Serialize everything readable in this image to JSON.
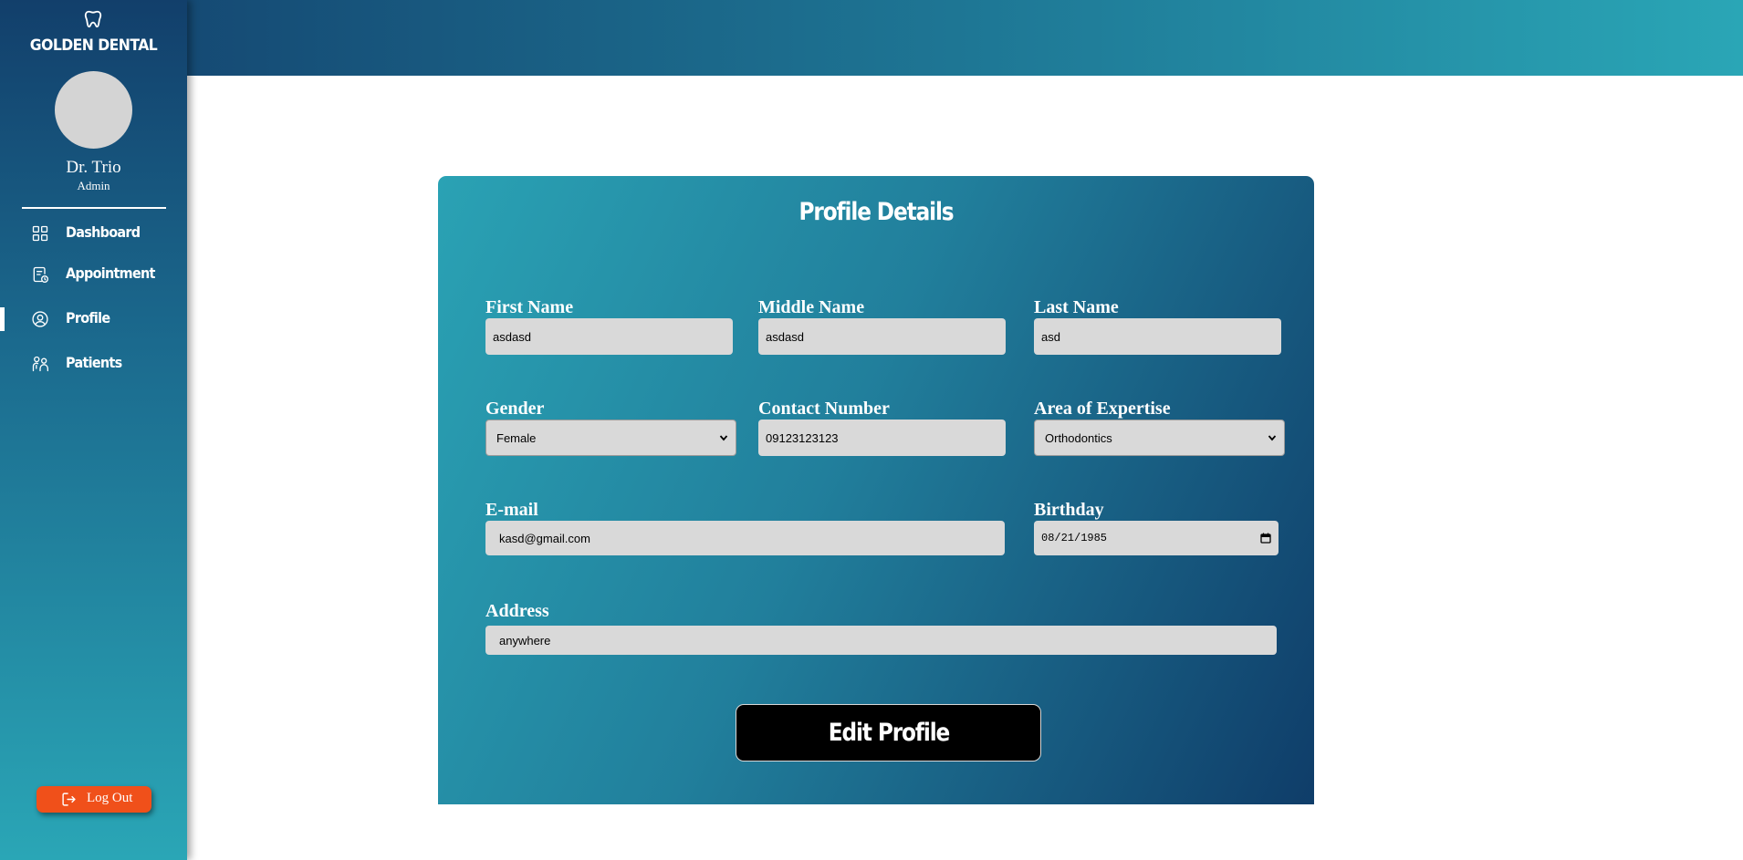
{
  "brand": {
    "name": "GOLDEN DENTAL",
    "icon": "tooth-icon"
  },
  "user": {
    "name": "Dr. Trio",
    "role": "Admin"
  },
  "nav": {
    "items": [
      {
        "label": "Dashboard",
        "icon": "grid-icon",
        "active": false
      },
      {
        "label": "Appointment",
        "icon": "calendar-clock-icon",
        "active": false
      },
      {
        "label": "Profile",
        "icon": "user-circle-icon",
        "active": true
      },
      {
        "label": "Patients",
        "icon": "patients-icon",
        "active": false
      }
    ]
  },
  "logout": {
    "label": "Log Out",
    "icon": "logout-icon"
  },
  "profile": {
    "title": "Profile Details",
    "first_name": {
      "label": "First Name",
      "value": "asdasd"
    },
    "middle_name": {
      "label": "Middle Name",
      "value": "asdasd"
    },
    "last_name": {
      "label": "Last Name",
      "value": "asd"
    },
    "gender": {
      "label": "Gender",
      "value": "Female"
    },
    "contact": {
      "label": "Contact Number",
      "value": "09123123123"
    },
    "expertise": {
      "label": "Area of Expertise",
      "value": "Orthodontics"
    },
    "email": {
      "label": "E-mail",
      "value": "kasd@gmail.com"
    },
    "birthday": {
      "label": "Birthday",
      "value": "08/21/1985"
    },
    "address": {
      "label": "Address",
      "value": "anywhere"
    },
    "edit_button": "Edit Profile"
  },
  "colors": {
    "sidebar_top": "#123f6b",
    "sidebar_bottom": "#2aa6b6",
    "logout": "#f0501a",
    "field_bg": "#d9d9d9"
  }
}
